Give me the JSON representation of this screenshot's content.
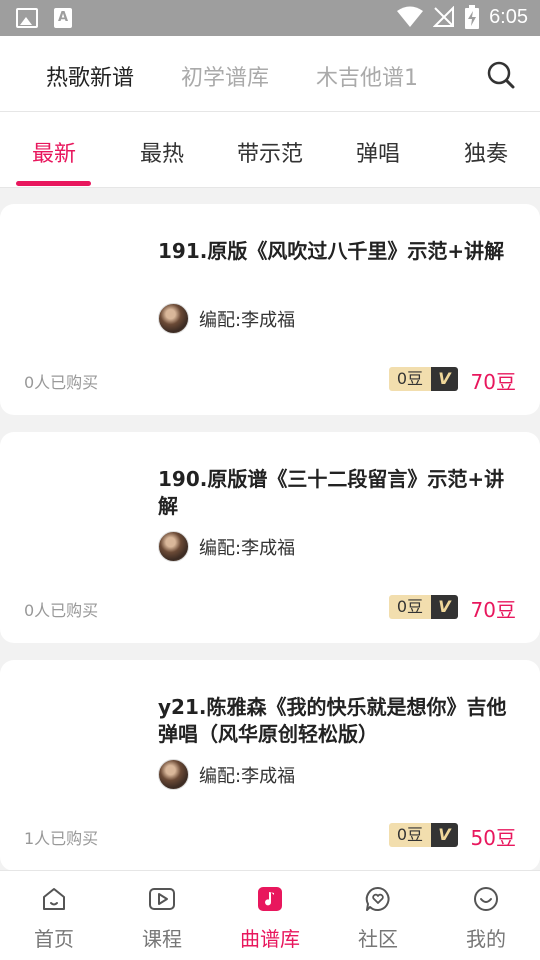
{
  "status_bar": {
    "time": "6:05"
  },
  "top_tabs": [
    {
      "label": "热歌新谱",
      "active": true
    },
    {
      "label": "初学谱库",
      "active": false
    },
    {
      "label": "木吉他谱1",
      "active": false
    }
  ],
  "category_tabs": [
    {
      "label": "最新",
      "active": true
    },
    {
      "label": "最热",
      "active": false
    },
    {
      "label": "带示范",
      "active": false
    },
    {
      "label": "弹唱",
      "active": false
    },
    {
      "label": "独奏",
      "active": false
    }
  ],
  "cards": [
    {
      "title": "191.原版《风吹过八千里》示范+讲解",
      "author_prefix": "编配:",
      "author": "李成福",
      "buyers": "0人已购买",
      "dou": "0豆",
      "vip": "V",
      "price": "70豆"
    },
    {
      "title": "190.原版谱《三十二段留言》示范+讲解",
      "author_prefix": "编配:",
      "author": "李成福",
      "buyers": "0人已购买",
      "dou": "0豆",
      "vip": "V",
      "price": "70豆"
    },
    {
      "title": "y21.陈雅森《我的快乐就是想你》吉他弹唱（风华原创轻松版）",
      "author_prefix": "编配:",
      "author": "李成福",
      "buyers": "1人已购买",
      "dou": "0豆",
      "vip": "V",
      "price": "50豆"
    }
  ],
  "bottom_nav": [
    {
      "label": "首页",
      "icon": "home-icon",
      "active": false
    },
    {
      "label": "课程",
      "icon": "video-play-icon",
      "active": false
    },
    {
      "label": "曲谱库",
      "icon": "music-note-icon",
      "active": true
    },
    {
      "label": "社区",
      "icon": "chat-heart-icon",
      "active": false
    },
    {
      "label": "我的",
      "icon": "smiley-icon",
      "active": false
    }
  ],
  "colors": {
    "accent": "#e8175d",
    "vip_gold": "#f2deae",
    "vip_dark": "#333333"
  }
}
